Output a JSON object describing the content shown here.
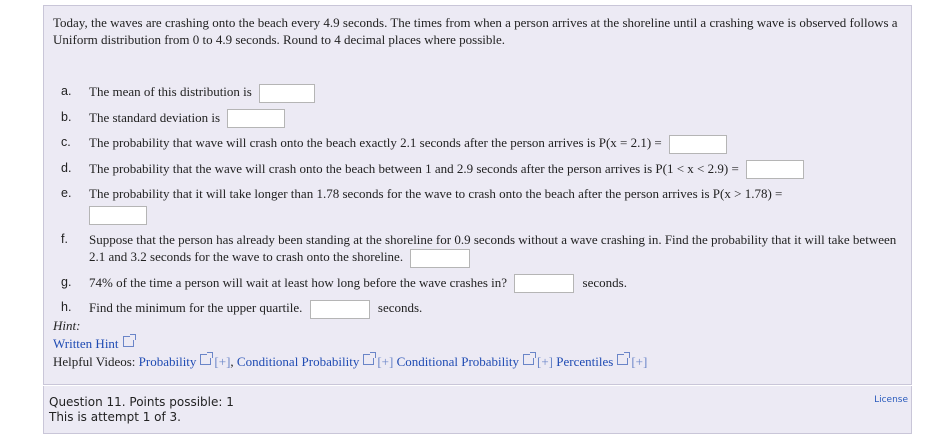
{
  "question": {
    "intro": "Today, the waves are crashing onto the beach every 4.9 seconds. The times from when a person arrives at the shoreline until a crashing wave is observed follows a Uniform distribution from 0 to 4.9 seconds. Round to 4 decimal places where possible.",
    "parts": [
      {
        "label": "a.",
        "text": "The mean of this distribution is"
      },
      {
        "label": "b.",
        "text": "The standard deviation is"
      },
      {
        "label": "c.",
        "text": "The probability that wave will crash onto the beach exactly 2.1 seconds after the person arrives is P(x = 2.1) ="
      },
      {
        "label": "d.",
        "text": "The probability that the wave will crash onto the beach between 1 and 2.9 seconds after the person arrives is P(1 < x < 2.9) ="
      },
      {
        "label": "e.",
        "text": "The probability that it will take longer than 1.78 seconds for the wave to crash onto the beach after the person arrives is P(x > 1.78) ="
      },
      {
        "label": "f.",
        "text": "Suppose that the person has already been standing at the shoreline for 0.9 seconds without a wave crashing in. Find the probability that it will take between 2.1 and 3.2 seconds for the wave to crash onto the shoreline."
      },
      {
        "label": "g.",
        "text": "74% of the time a person will wait at least how long before the wave crashes in?",
        "unit": "seconds."
      },
      {
        "label": "h.",
        "text": "Find the minimum for the upper quartile.",
        "unit": "seconds."
      }
    ]
  },
  "hint": {
    "title": "Hint:",
    "written_hint": "Written Hint",
    "videos_label": "Helpful Videos:",
    "videos": [
      "Probability",
      "Conditional Probability",
      "Conditional Probability",
      "Percentiles"
    ],
    "plus": "[+]",
    "separator": ","
  },
  "footer": {
    "points": "Question 11. Points possible: 1",
    "attempt": "This is attempt 1 of 3.",
    "license": "License"
  }
}
